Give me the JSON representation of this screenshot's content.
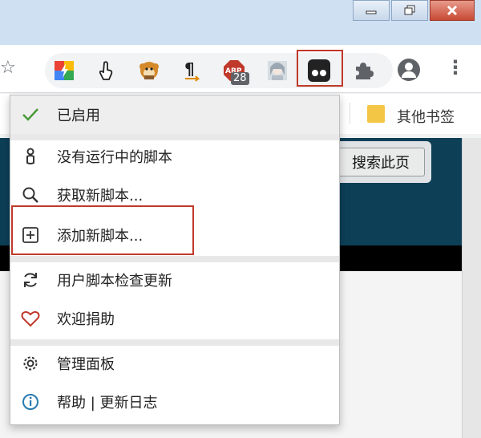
{
  "window": {
    "minimize_icon": "minimize-icon",
    "maximize_icon": "restore-icon",
    "close_icon": "close-icon",
    "close_color": "#c94a35"
  },
  "toolbar": {
    "bookmark_star_icon": "star-icon",
    "extensions": [
      {
        "name": "ext-colorful-icon",
        "color": "#4285f4"
      },
      {
        "name": "ext-pointer-icon",
        "color": "#333333"
      },
      {
        "name": "ext-monkey-icon",
        "color": "#c77a1d"
      },
      {
        "name": "ext-pilcrow-icon",
        "color": "#d98b00"
      },
      {
        "name": "ext-abp-icon",
        "color": "#c0392b"
      },
      {
        "name": "ext-anime-icon",
        "color": "#9aa6b1"
      }
    ],
    "abp_label": "ABP",
    "abp_badge": "28",
    "tampermonkey_icon": "tampermonkey-icon",
    "highlight_color": "#c0392b"
  },
  "bookmarks": {
    "other_bookmarks": "其他书签"
  },
  "page": {
    "search_button": "搜索此页"
  },
  "menu": {
    "items": [
      {
        "icon": "check-icon",
        "label": "已启用",
        "active": true
      },
      {
        "icon": "script-running-icon",
        "label": "没有运行中的脚本"
      },
      {
        "icon": "search-icon",
        "label": "获取新脚本..."
      },
      {
        "icon": "plus-box-icon",
        "label": "添加新脚本..."
      },
      {
        "icon": "refresh-icon",
        "label": "用户脚本检查更新"
      },
      {
        "icon": "heart-icon",
        "label": "欢迎捐助"
      },
      {
        "icon": "gear-icon",
        "label": "管理面板"
      },
      {
        "icon": "info-icon",
        "label": "帮助 | 更新日志"
      }
    ]
  }
}
